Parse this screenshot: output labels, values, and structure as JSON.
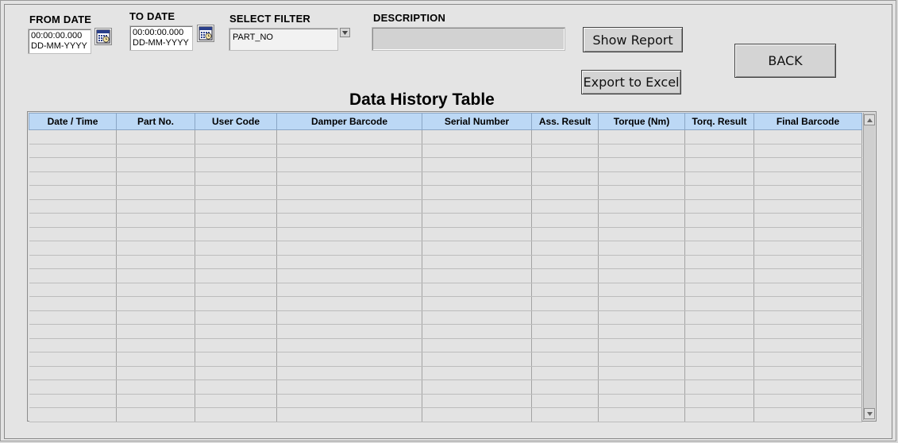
{
  "filters": {
    "from_date": {
      "label": "FROM DATE",
      "time": "00:00:00.000",
      "format": "DD-MM-YYYY"
    },
    "to_date": {
      "label": "TO DATE",
      "time": "00:00:00.000",
      "format": "DD-MM-YYYY"
    },
    "select_filter": {
      "label": "SELECT FILTER",
      "value": "PART_NO"
    },
    "description": {
      "label": "DESCRIPTION",
      "value": ""
    }
  },
  "buttons": {
    "show_report": "Show Report",
    "export_excel": "Export to Excel",
    "back": "BACK"
  },
  "table": {
    "title": "Data History Table",
    "columns": [
      "Date / Time",
      "Part No.",
      "User Code",
      "Damper Barcode",
      "Serial Number",
      "Ass. Result",
      "Torque (Nm)",
      "Torq. Result",
      "Final Barcode"
    ],
    "empty_row_count": 21
  },
  "icons": {
    "calendar": "calendar-icon",
    "dropdown": "chevron-down-icon",
    "scroll_up": "scroll-up-arrow-icon",
    "scroll_down": "scroll-down-arrow-icon"
  },
  "colors": {
    "header_bg": "#bcd8f5",
    "panel_bg": "#e3e3e3"
  }
}
